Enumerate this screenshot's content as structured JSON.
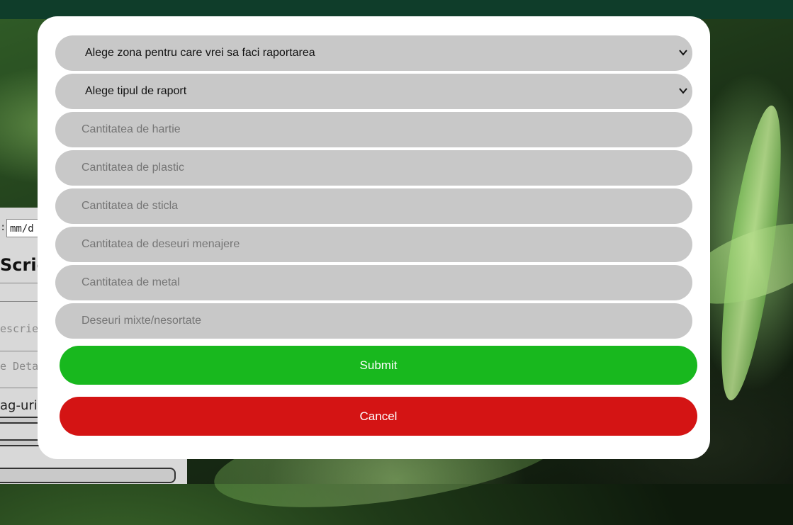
{
  "background_form": {
    "date_placeholder": "mm/d",
    "heading": "Scrie",
    "description_placeholder": "escrie",
    "details_placeholder": "e Deta",
    "tags_label": "ag-uri"
  },
  "modal": {
    "zone_select": {
      "selected": "Alege zona pentru care vrei sa faci raportarea",
      "icon": "chevron-down-icon"
    },
    "report_type_select": {
      "selected": "Alege tipul de raport",
      "icon": "chevron-down-icon"
    },
    "fields": [
      {
        "placeholder": "Cantitatea de hartie"
      },
      {
        "placeholder": "Cantitatea de plastic"
      },
      {
        "placeholder": "Cantitatea de sticla"
      },
      {
        "placeholder": "Cantitatea de deseuri menajere"
      },
      {
        "placeholder": "Cantitatea de metal"
      },
      {
        "placeholder": "Deseuri mixte/nesortate"
      }
    ],
    "submit_label": "Submit",
    "cancel_label": "Cancel"
  },
  "colors": {
    "submit": "#18b81e",
    "cancel": "#d41414",
    "field_bg": "#c8c8c8",
    "topbar": "#0f3d2a"
  }
}
